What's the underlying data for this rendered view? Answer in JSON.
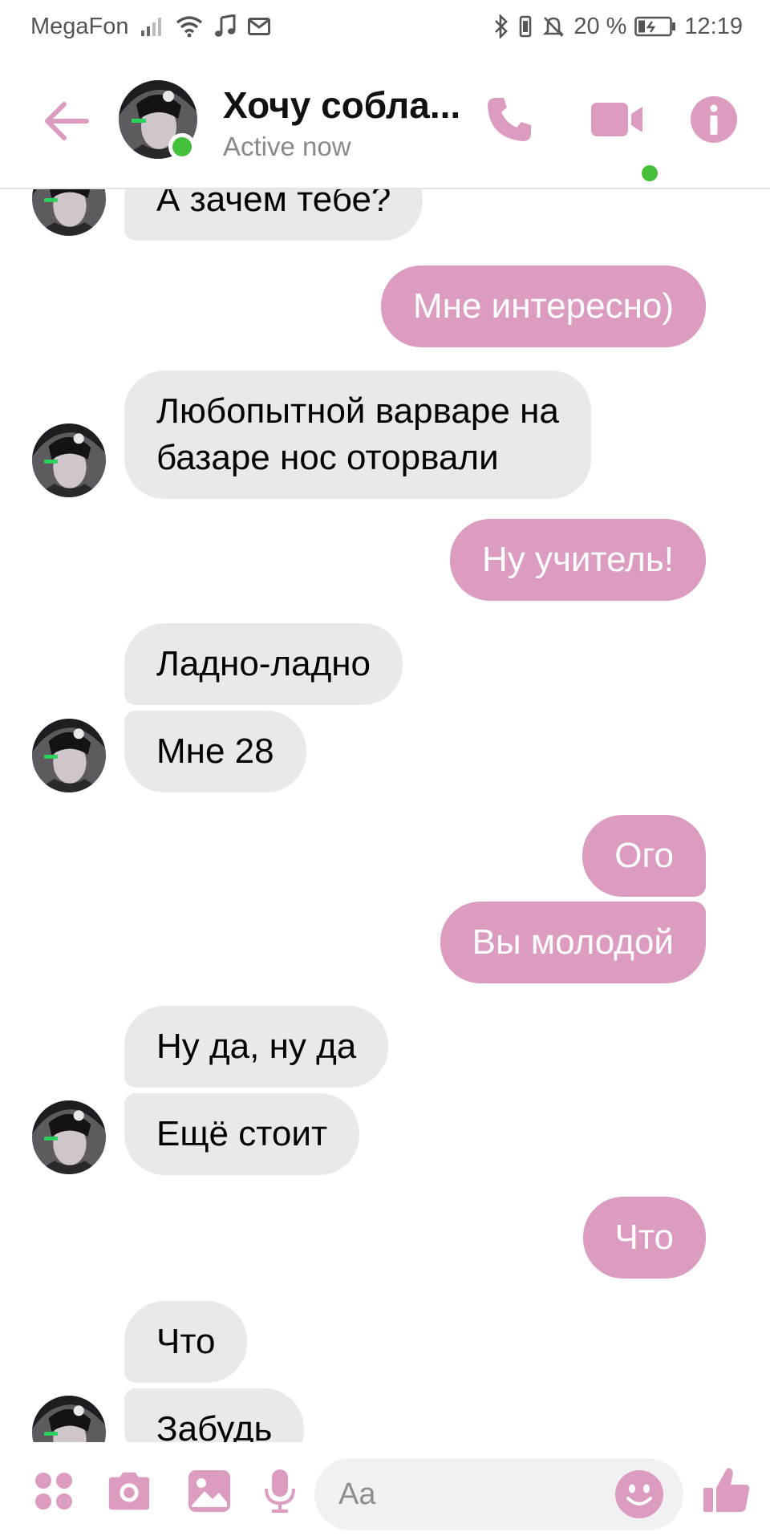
{
  "status_bar": {
    "carrier": "MegaFon",
    "battery_percent": "20 %",
    "time": "12:19",
    "icons": [
      "signal-icon",
      "wifi-icon",
      "music-note-icon",
      "mail-icon",
      "bluetooth-icon",
      "vibrate-icon",
      "mute-icon",
      "battery-icon"
    ]
  },
  "header": {
    "contact_name": "Хочу собла...",
    "status": "Active now",
    "accent_color": "#dc9cbf",
    "presence_color": "#44bf3a"
  },
  "messages": [
    {
      "dir": "in",
      "text": "А зачем тебе?",
      "avatar": true
    },
    {
      "dir": "out",
      "text": "Мне интересно)"
    },
    {
      "dir": "in",
      "text": "Любопытной варваре на\nбазаре нос оторвали",
      "avatar": true
    },
    {
      "dir": "out",
      "text": "Ну учитель!"
    },
    {
      "dir": "in",
      "text": "Ладно-ладно"
    },
    {
      "dir": "in",
      "text": "Мне 28",
      "avatar": true
    },
    {
      "dir": "out",
      "text": "Ого"
    },
    {
      "dir": "out",
      "text": "Вы молодой"
    },
    {
      "dir": "in",
      "text": "Ну да, ну да"
    },
    {
      "dir": "in",
      "text": "Ещё стоит",
      "avatar": true
    },
    {
      "dir": "out",
      "text": "Что"
    },
    {
      "dir": "in",
      "text": "Что"
    },
    {
      "dir": "in",
      "text": "Забудь",
      "avatar": true
    }
  ],
  "composer": {
    "placeholder": "Aa",
    "icons": [
      "apps-icon",
      "camera-icon",
      "gallery-icon",
      "microphone-icon",
      "emoji-icon",
      "thumbs-up-icon"
    ]
  }
}
